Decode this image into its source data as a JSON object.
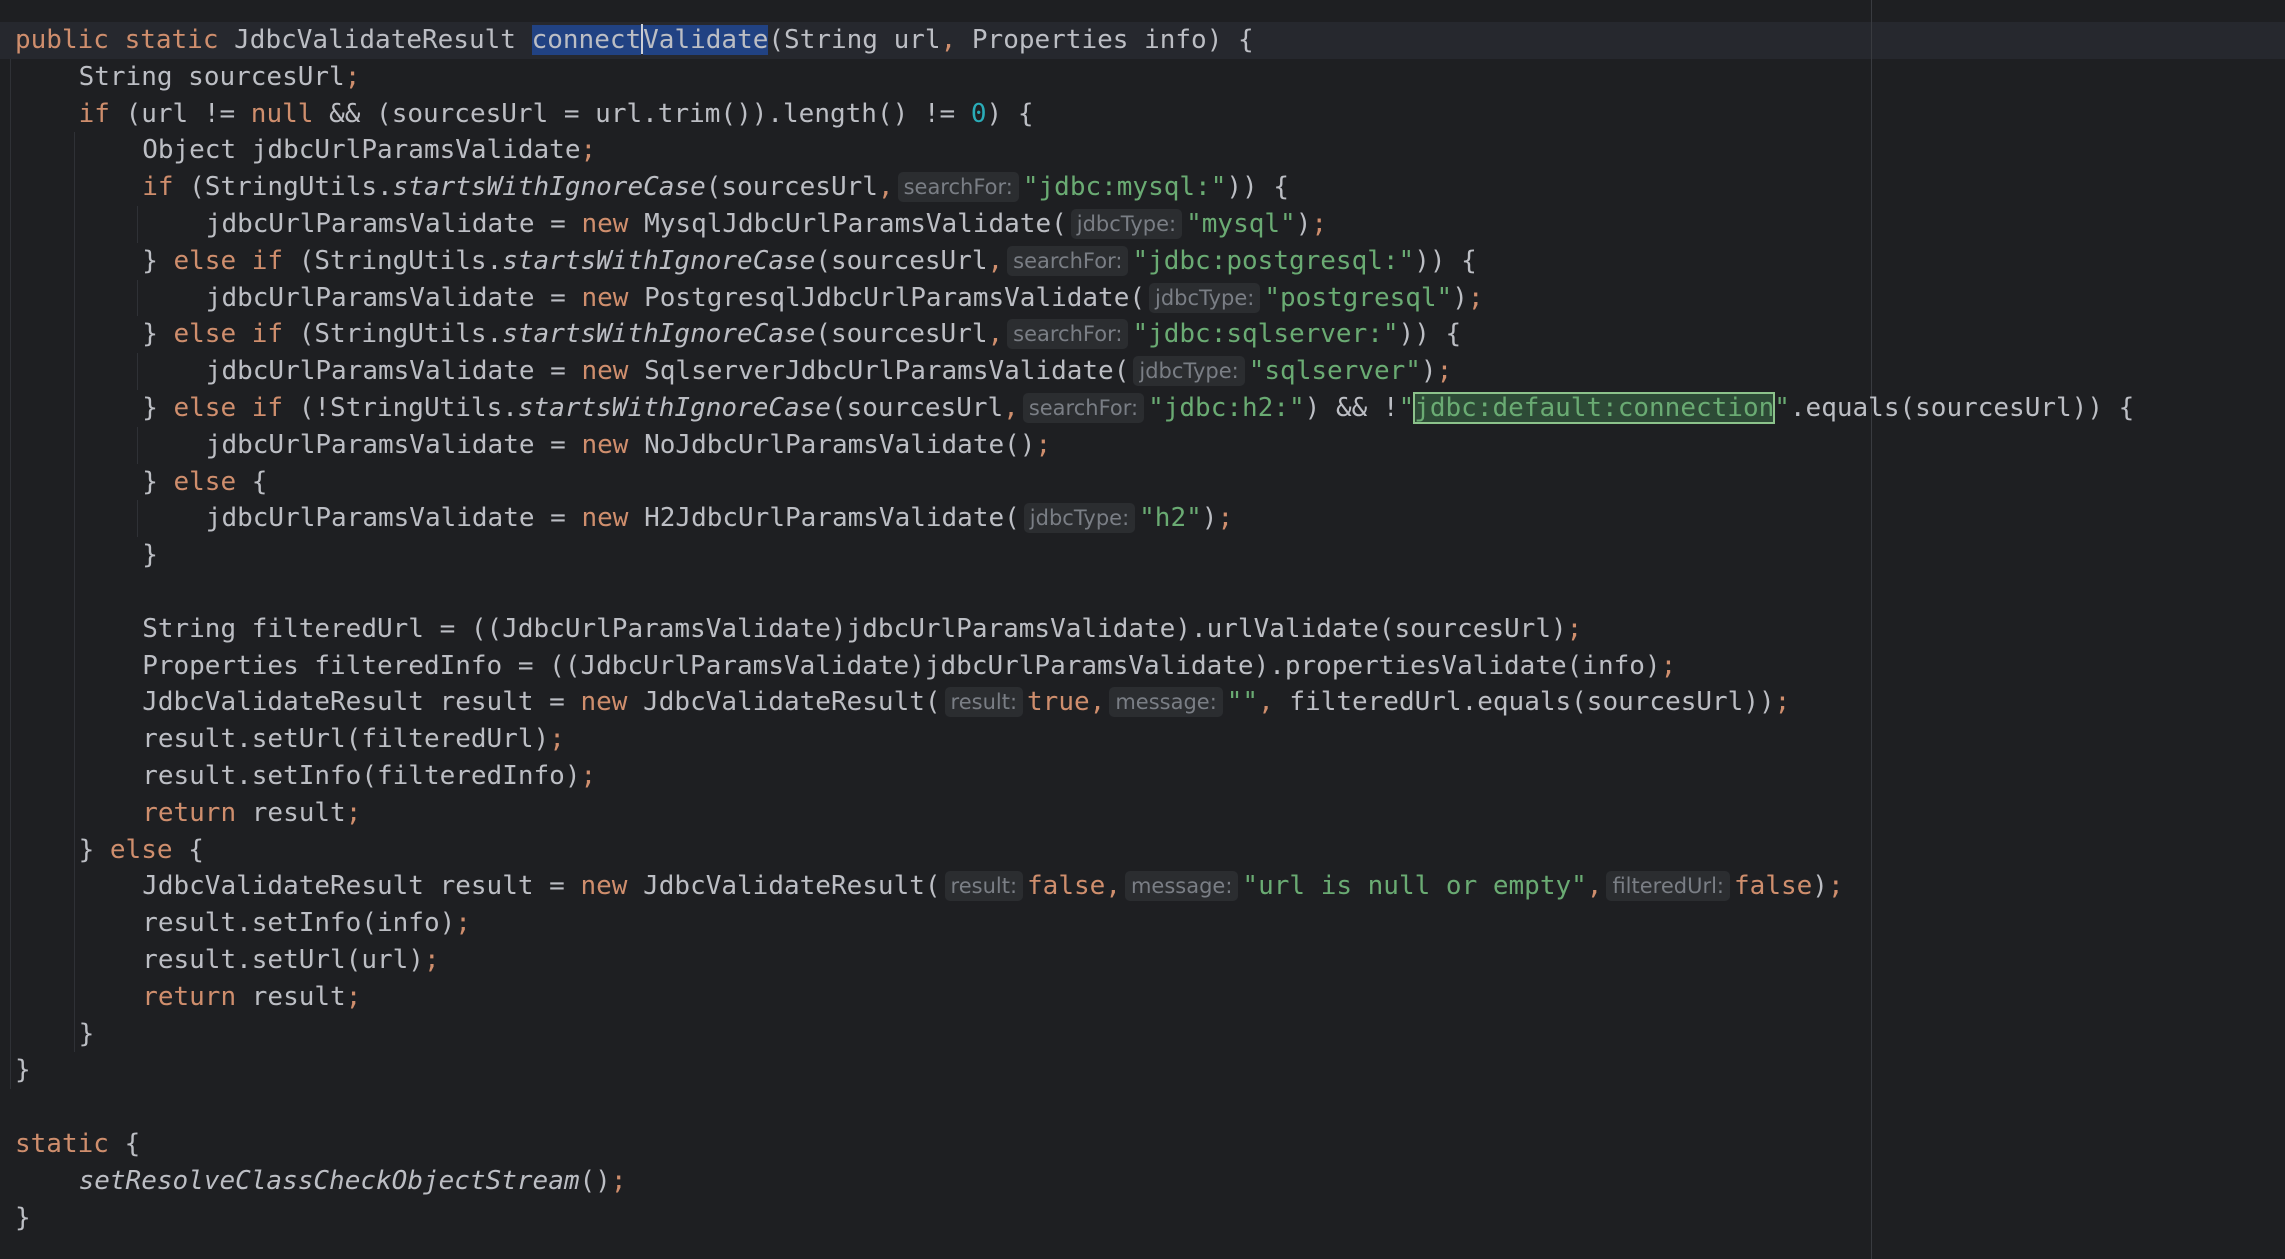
{
  "editor": {
    "indent_guides": [
      {
        "col": 0,
        "from": 1,
        "to": 28
      },
      {
        "col": 4,
        "from": 3,
        "to": 27
      },
      {
        "col": 8,
        "from": 5,
        "to": 5
      },
      {
        "col": 8,
        "from": 7,
        "to": 7
      },
      {
        "col": 8,
        "from": 9,
        "to": 9
      },
      {
        "col": 8,
        "from": 11,
        "to": 11
      },
      {
        "col": 8,
        "from": 13,
        "to": 13
      }
    ],
    "lines": [
      {
        "indent": 0,
        "current": true,
        "tokens": [
          {
            "c": "kw",
            "t": "public static "
          },
          {
            "t": "JdbcValidateResult "
          },
          {
            "c": "sel-word",
            "t": "connect",
            "n": "method-name-highlight"
          },
          {
            "c": "caret",
            "t": "",
            "n": "text-caret"
          },
          {
            "c": "sel-word",
            "t": "Validate",
            "n": "method-name-highlight"
          },
          {
            "t": "(String url"
          },
          {
            "c": "punc",
            "t": ", "
          },
          {
            "t": "Properties info) {"
          }
        ]
      },
      {
        "indent": 4,
        "tokens": [
          {
            "t": "String sourcesUrl"
          },
          {
            "c": "punc",
            "t": ";"
          }
        ]
      },
      {
        "indent": 4,
        "tokens": [
          {
            "c": "kw",
            "t": "if "
          },
          {
            "t": "(url != "
          },
          {
            "c": "kw",
            "t": "null "
          },
          {
            "t": "&& (sourcesUrl = url.trim()).length() != "
          },
          {
            "c": "num",
            "t": "0"
          },
          {
            "t": ") {"
          }
        ]
      },
      {
        "indent": 8,
        "tokens": [
          {
            "t": "Object jdbcUrlParamsValidate"
          },
          {
            "c": "punc",
            "t": ";"
          }
        ]
      },
      {
        "indent": 8,
        "tokens": [
          {
            "c": "kw",
            "t": "if "
          },
          {
            "t": "(StringUtils."
          },
          {
            "c": "it",
            "t": "startsWithIgnoreCase"
          },
          {
            "t": "(sourcesUrl"
          },
          {
            "c": "punc",
            "t": ","
          },
          {
            "c": "hint",
            "t": "searchFor:"
          },
          {
            "c": "str",
            "t": "\"jdbc:mysql:\""
          },
          {
            "t": ")) {"
          }
        ]
      },
      {
        "indent": 12,
        "tokens": [
          {
            "t": "jdbcUrlParamsValidate = "
          },
          {
            "c": "kw",
            "t": "new "
          },
          {
            "t": "MysqlJdbcUrlParamsValidate("
          },
          {
            "c": "hint",
            "t": "jdbcType:"
          },
          {
            "c": "str",
            "t": "\"mysql\""
          },
          {
            "t": ")"
          },
          {
            "c": "punc",
            "t": ";"
          }
        ]
      },
      {
        "indent": 8,
        "tokens": [
          {
            "t": "} "
          },
          {
            "c": "kw",
            "t": "else if "
          },
          {
            "t": "(StringUtils."
          },
          {
            "c": "it",
            "t": "startsWithIgnoreCase"
          },
          {
            "t": "(sourcesUrl"
          },
          {
            "c": "punc",
            "t": ","
          },
          {
            "c": "hint",
            "t": "searchFor:"
          },
          {
            "c": "str",
            "t": "\"jdbc:postgresql:\""
          },
          {
            "t": ")) {"
          }
        ]
      },
      {
        "indent": 12,
        "tokens": [
          {
            "t": "jdbcUrlParamsValidate = "
          },
          {
            "c": "kw",
            "t": "new "
          },
          {
            "t": "PostgresqlJdbcUrlParamsValidate("
          },
          {
            "c": "hint",
            "t": "jdbcType:"
          },
          {
            "c": "str",
            "t": "\"postgresql\""
          },
          {
            "t": ")"
          },
          {
            "c": "punc",
            "t": ";"
          }
        ]
      },
      {
        "indent": 8,
        "tokens": [
          {
            "t": "} "
          },
          {
            "c": "kw",
            "t": "else if "
          },
          {
            "t": "(StringUtils."
          },
          {
            "c": "it",
            "t": "startsWithIgnoreCase"
          },
          {
            "t": "(sourcesUrl"
          },
          {
            "c": "punc",
            "t": ","
          },
          {
            "c": "hint",
            "t": "searchFor:"
          },
          {
            "c": "str",
            "t": "\"jdbc:sqlserver:\""
          },
          {
            "t": ")) {"
          }
        ]
      },
      {
        "indent": 12,
        "tokens": [
          {
            "t": "jdbcUrlParamsValidate = "
          },
          {
            "c": "kw",
            "t": "new "
          },
          {
            "t": "SqlserverJdbcUrlParamsValidate("
          },
          {
            "c": "hint",
            "t": "jdbcType:"
          },
          {
            "c": "str",
            "t": "\"sqlserver\""
          },
          {
            "t": ")"
          },
          {
            "c": "punc",
            "t": ";"
          }
        ]
      },
      {
        "indent": 8,
        "tokens": [
          {
            "t": "} "
          },
          {
            "c": "kw",
            "t": "else if "
          },
          {
            "t": "(!StringUtils."
          },
          {
            "c": "it",
            "t": "startsWithIgnoreCase"
          },
          {
            "t": "(sourcesUrl"
          },
          {
            "c": "punc",
            "t": ","
          },
          {
            "c": "hint",
            "t": "searchFor:"
          },
          {
            "c": "str",
            "t": "\"jdbc:h2:\""
          },
          {
            "t": ") && !"
          },
          {
            "c": "str",
            "t": "\""
          },
          {
            "c": "found",
            "t": "jdbc:default:connection",
            "n": "search-match-highlight"
          },
          {
            "c": "str",
            "t": "\""
          },
          {
            "t": ".equals(sourcesUrl)) {"
          }
        ]
      },
      {
        "indent": 12,
        "tokens": [
          {
            "t": "jdbcUrlParamsValidate = "
          },
          {
            "c": "kw",
            "t": "new "
          },
          {
            "t": "NoJdbcUrlParamsValidate()"
          },
          {
            "c": "punc",
            "t": ";"
          }
        ]
      },
      {
        "indent": 8,
        "tokens": [
          {
            "t": "} "
          },
          {
            "c": "kw",
            "t": "else "
          },
          {
            "t": "{"
          }
        ]
      },
      {
        "indent": 12,
        "tokens": [
          {
            "t": "jdbcUrlParamsValidate = "
          },
          {
            "c": "kw",
            "t": "new "
          },
          {
            "t": "H2JdbcUrlParamsValidate("
          },
          {
            "c": "hint",
            "t": "jdbcType:"
          },
          {
            "c": "str",
            "t": "\"h2\""
          },
          {
            "t": ")"
          },
          {
            "c": "punc",
            "t": ";"
          }
        ]
      },
      {
        "indent": 8,
        "tokens": [
          {
            "t": "}"
          }
        ]
      },
      {
        "indent": 0,
        "tokens": []
      },
      {
        "indent": 8,
        "tokens": [
          {
            "t": "String filteredUrl = ((JdbcUrlParamsValidate)jdbcUrlParamsValidate).urlValidate(sourcesUrl)"
          },
          {
            "c": "punc",
            "t": ";"
          }
        ]
      },
      {
        "indent": 8,
        "tokens": [
          {
            "t": "Properties filteredInfo = ((JdbcUrlParamsValidate)jdbcUrlParamsValidate).propertiesValidate(info)"
          },
          {
            "c": "punc",
            "t": ";"
          }
        ]
      },
      {
        "indent": 8,
        "tokens": [
          {
            "t": "JdbcValidateResult result = "
          },
          {
            "c": "kw",
            "t": "new "
          },
          {
            "t": "JdbcValidateResult("
          },
          {
            "c": "hint",
            "t": "result:"
          },
          {
            "c": "kw",
            "t": "true"
          },
          {
            "c": "punc",
            "t": ","
          },
          {
            "c": "hint",
            "t": "message:"
          },
          {
            "c": "str",
            "t": "\"\""
          },
          {
            "c": "punc",
            "t": ", "
          },
          {
            "t": "filteredUrl.equals(sourcesUrl))"
          },
          {
            "c": "punc",
            "t": ";"
          }
        ]
      },
      {
        "indent": 8,
        "tokens": [
          {
            "t": "result.setUrl(filteredUrl)"
          },
          {
            "c": "punc",
            "t": ";"
          }
        ]
      },
      {
        "indent": 8,
        "tokens": [
          {
            "t": "result.setInfo(filteredInfo)"
          },
          {
            "c": "punc",
            "t": ";"
          }
        ]
      },
      {
        "indent": 8,
        "tokens": [
          {
            "c": "kw",
            "t": "return "
          },
          {
            "t": "result"
          },
          {
            "c": "punc",
            "t": ";"
          }
        ]
      },
      {
        "indent": 4,
        "tokens": [
          {
            "t": "} "
          },
          {
            "c": "kw",
            "t": "else "
          },
          {
            "t": "{"
          }
        ]
      },
      {
        "indent": 8,
        "tokens": [
          {
            "t": "JdbcValidateResult result = "
          },
          {
            "c": "kw",
            "t": "new "
          },
          {
            "t": "JdbcValidateResult("
          },
          {
            "c": "hint",
            "t": "result:"
          },
          {
            "c": "kw",
            "t": "false"
          },
          {
            "c": "punc",
            "t": ","
          },
          {
            "c": "hint",
            "t": "message:"
          },
          {
            "c": "str",
            "t": "\"url is null or empty\""
          },
          {
            "c": "punc",
            "t": ","
          },
          {
            "c": "hint",
            "t": "filteredUrl:"
          },
          {
            "c": "kw",
            "t": "false"
          },
          {
            "t": ")"
          },
          {
            "c": "punc",
            "t": ";"
          }
        ]
      },
      {
        "indent": 8,
        "tokens": [
          {
            "t": "result.setInfo(info)"
          },
          {
            "c": "punc",
            "t": ";"
          }
        ]
      },
      {
        "indent": 8,
        "tokens": [
          {
            "t": "result.setUrl(url)"
          },
          {
            "c": "punc",
            "t": ";"
          }
        ]
      },
      {
        "indent": 8,
        "tokens": [
          {
            "c": "kw",
            "t": "return "
          },
          {
            "t": "result"
          },
          {
            "c": "punc",
            "t": ";"
          }
        ]
      },
      {
        "indent": 4,
        "tokens": [
          {
            "t": "}"
          }
        ]
      },
      {
        "indent": 0,
        "tokens": [
          {
            "t": "}"
          }
        ]
      },
      {
        "indent": 0,
        "tokens": []
      },
      {
        "indent": 0,
        "tokens": [
          {
            "c": "kw",
            "t": "static "
          },
          {
            "t": "{"
          }
        ]
      },
      {
        "indent": 4,
        "tokens": [
          {
            "c": "it",
            "t": "setResolveClassCheckObjectStream"
          },
          {
            "t": "()"
          },
          {
            "c": "punc",
            "t": ";"
          }
        ]
      },
      {
        "indent": 0,
        "tokens": [
          {
            "t": "}"
          }
        ]
      }
    ]
  }
}
